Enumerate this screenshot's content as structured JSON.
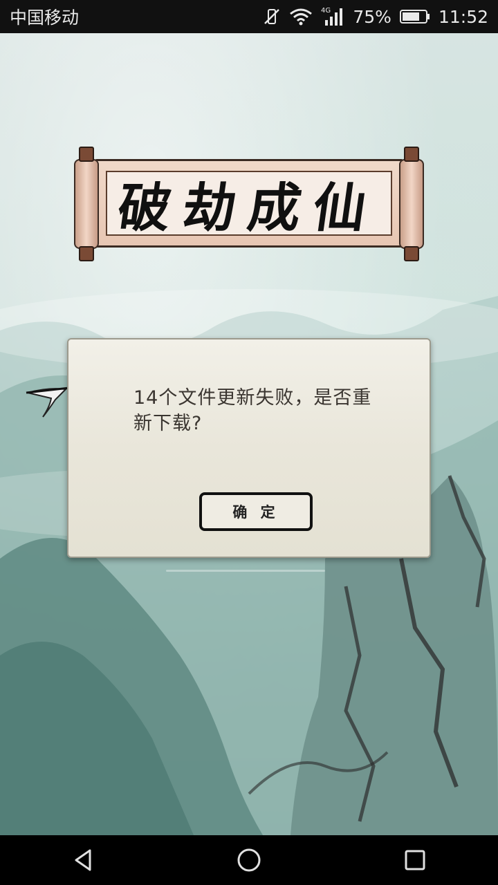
{
  "status_bar": {
    "carrier": "中国移动",
    "network": "4G",
    "battery_percent": "75%",
    "time": "11:52",
    "icons": [
      "mute-vibrate-icon",
      "wifi-icon",
      "signal-icon",
      "battery-icon"
    ]
  },
  "app": {
    "title": "破劫成仙"
  },
  "dialog": {
    "message": "14个文件更新失败，是否重新下载?",
    "confirm_label": "确 定"
  },
  "nav_bar": {
    "icons": [
      "back-icon",
      "home-icon",
      "recents-icon"
    ]
  },
  "colors": {
    "status_bar_bg": "#111111",
    "dialog_bg": "#ecebe2",
    "button_border": "#111111",
    "nav_bar_bg": "#000000"
  }
}
